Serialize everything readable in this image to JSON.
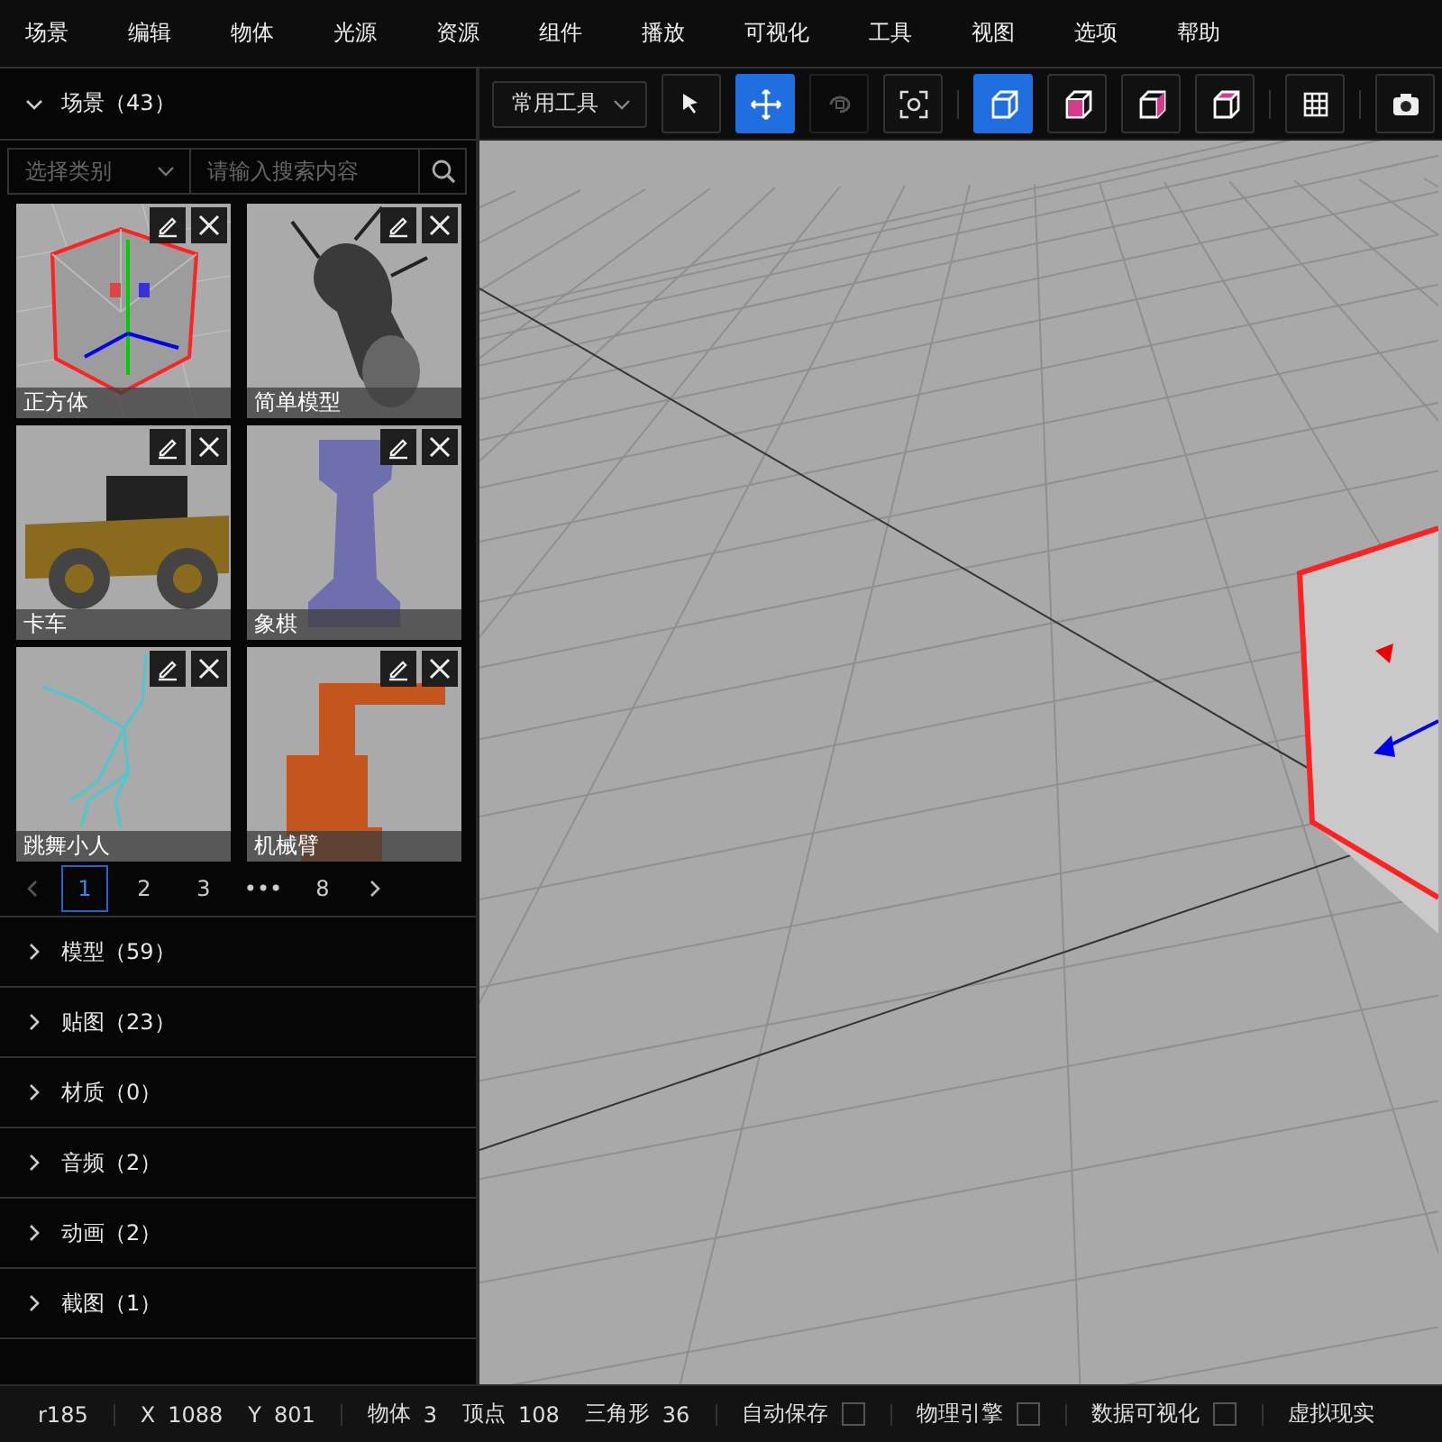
{
  "menu": [
    "场景",
    "编辑",
    "物体",
    "光源",
    "资源",
    "组件",
    "播放",
    "可视化",
    "工具",
    "视图",
    "选项",
    "帮助"
  ],
  "sidebar": {
    "scene_section": {
      "title": "场景（43）",
      "expanded": true
    },
    "category_select": {
      "placeholder": "选择类别"
    },
    "search": {
      "placeholder": "请输入搜索内容"
    },
    "assets": [
      {
        "name": "正方体",
        "kind": "cube"
      },
      {
        "name": "简单模型",
        "kind": "beetle"
      },
      {
        "name": "卡车",
        "kind": "truck"
      },
      {
        "name": "象棋",
        "kind": "chess"
      },
      {
        "name": "跳舞小人",
        "kind": "skeleton"
      },
      {
        "name": "机械臂",
        "kind": "arm"
      }
    ],
    "pagination": [
      {
        "label": "1",
        "selected": true
      },
      {
        "label": "2",
        "selected": false
      },
      {
        "label": "3",
        "selected": false
      },
      {
        "label": "•••",
        "selected": false
      },
      {
        "label": "8",
        "selected": false
      }
    ],
    "sections": [
      {
        "title": "模型（59）",
        "expanded": false
      },
      {
        "title": "贴图（23）",
        "expanded": false
      },
      {
        "title": "材质（0）",
        "expanded": false
      },
      {
        "title": "音频（2）",
        "expanded": false
      },
      {
        "title": "动画（2）",
        "expanded": false
      },
      {
        "title": "截图（1）",
        "expanded": false
      }
    ]
  },
  "toolbar": {
    "dropdown": "常用工具",
    "tools": [
      {
        "kind": "select",
        "selected": false,
        "disabled": false
      },
      {
        "kind": "move",
        "selected": true,
        "disabled": false
      },
      {
        "kind": "rotate",
        "selected": false,
        "disabled": true
      },
      {
        "kind": "focus",
        "selected": false,
        "disabled": false
      },
      {
        "kind": "sep"
      },
      {
        "kind": "view-wire",
        "selected": true,
        "disabled": false
      },
      {
        "kind": "view-front",
        "selected": false,
        "disabled": false
      },
      {
        "kind": "view-side",
        "selected": false,
        "disabled": false
      },
      {
        "kind": "view-top",
        "selected": false,
        "disabled": false
      },
      {
        "kind": "sep"
      },
      {
        "kind": "grid",
        "selected": false,
        "disabled": false
      },
      {
        "kind": "sep"
      },
      {
        "kind": "camera",
        "selected": false,
        "disabled": false
      }
    ]
  },
  "status_bar": {
    "items": [
      {
        "kind": "text",
        "value": "r185"
      },
      {
        "kind": "sep"
      },
      {
        "kind": "pair",
        "label": "X",
        "value": "1088"
      },
      {
        "kind": "pair",
        "label": "Y",
        "value": "801"
      },
      {
        "kind": "sep"
      },
      {
        "kind": "pair",
        "label": "物体",
        "value": "3"
      },
      {
        "kind": "pair",
        "label": "顶点",
        "value": "108"
      },
      {
        "kind": "pair",
        "label": "三角形",
        "value": "36"
      },
      {
        "kind": "sep"
      },
      {
        "kind": "check",
        "label": "自动保存",
        "checked": false
      },
      {
        "kind": "sep"
      },
      {
        "kind": "check",
        "label": "物理引擎",
        "checked": false
      },
      {
        "kind": "sep"
      },
      {
        "kind": "check",
        "label": "数据可视化",
        "checked": false
      },
      {
        "kind": "sep"
      },
      {
        "kind": "text",
        "value": "虚拟现实"
      }
    ]
  }
}
